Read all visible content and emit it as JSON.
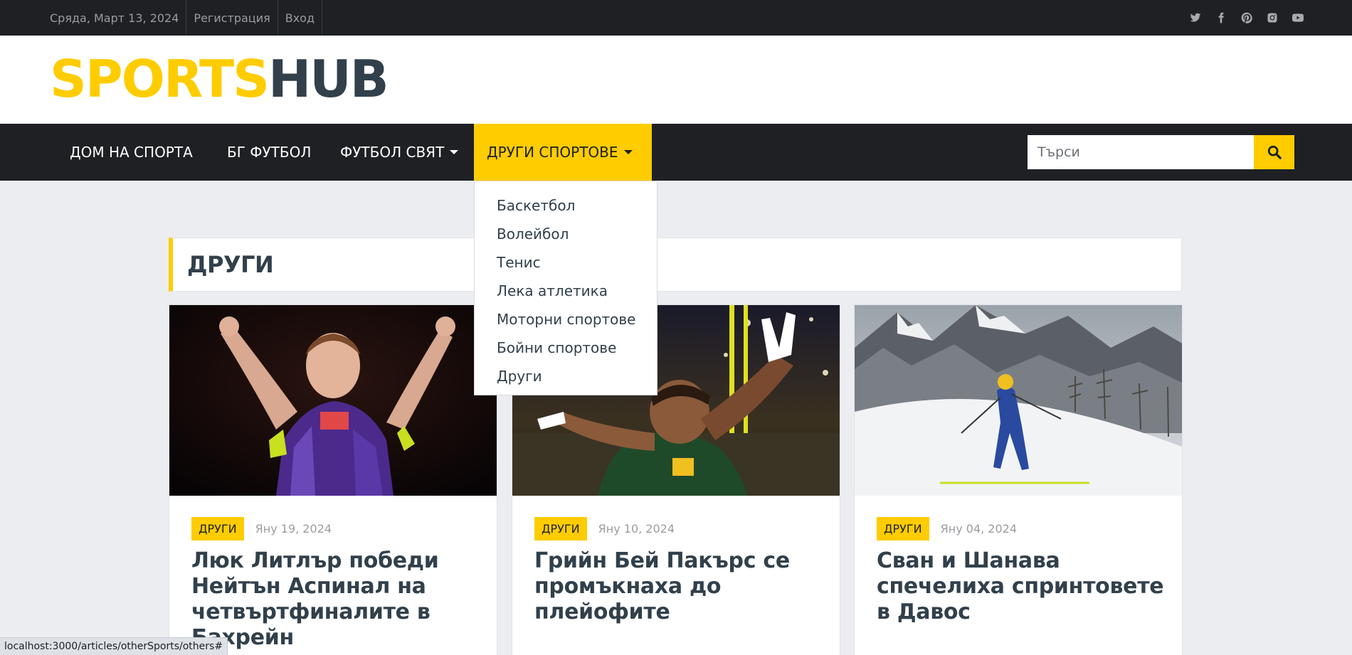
{
  "topbar": {
    "date": "Сряда, Март 13, 2024",
    "register": "Регистрация",
    "login": "Вход",
    "social": [
      "twitter-icon",
      "facebook-icon",
      "pinterest-icon",
      "instagram-icon",
      "youtube-icon"
    ]
  },
  "logo": {
    "part1": "SPORTS",
    "part2": "HUB"
  },
  "nav": {
    "items": [
      {
        "label": "ДОМ НА СПОРТА"
      },
      {
        "label": "БГ ФУТБОЛ"
      },
      {
        "label": "ФУТБОЛ СВЯТ"
      },
      {
        "label": "ДРУГИ СПОРТОВЕ"
      }
    ],
    "dropdown": [
      "Баскетбол",
      "Волейбол",
      "Тенис",
      "Лека атлетика",
      "Моторни спортове",
      "Бойни спортове",
      "Други"
    ]
  },
  "search": {
    "placeholder": "Търси"
  },
  "section": {
    "title": "ДРУГИ"
  },
  "cards": [
    {
      "category": "ДРУГИ",
      "date": "Яну 19, 2024",
      "title": "Люк Литлър победи Нейтън Аспинал на четвъртфиналите в Бахрейн"
    },
    {
      "category": "ДРУГИ",
      "date": "Яну 10, 2024",
      "title": "Грийн Бей Пакърс се промъкнаха до плейофите"
    },
    {
      "category": "ДРУГИ",
      "date": "Яну 04, 2024",
      "title": "Сван и Шанава спечелиха спринтовете в Давос"
    }
  ],
  "statusbar": {
    "url": "localhost:3000/articles/otherSports/others#"
  },
  "colors": {
    "accent": "#FFCC00",
    "dark": "#1E2024",
    "text": "#31404B"
  }
}
